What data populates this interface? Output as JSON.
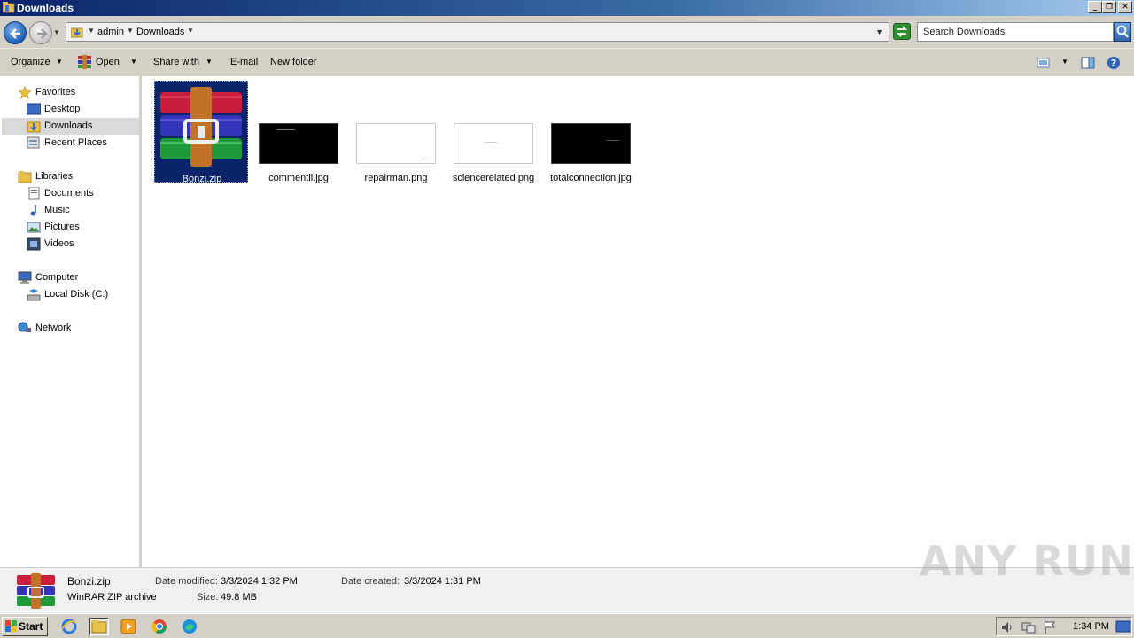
{
  "window": {
    "title": "Downloads"
  },
  "caption_buttons": {
    "minimize": "_",
    "restore": "❐",
    "close": "✕"
  },
  "address": {
    "breadcrumbs": [
      "admin",
      "Downloads"
    ],
    "search_placeholder": "Search Downloads"
  },
  "toolbar": {
    "organize": "Organize",
    "open": "Open",
    "share_with": "Share with",
    "email": "E-mail",
    "new_folder": "New folder"
  },
  "nav": {
    "favorites": "Favorites",
    "desktop": "Desktop",
    "downloads": "Downloads",
    "recent_places": "Recent Places",
    "libraries": "Libraries",
    "documents": "Documents",
    "music": "Music",
    "pictures": "Pictures",
    "videos": "Videos",
    "computer": "Computer",
    "local_disk": "Local Disk (C:)",
    "network": "Network"
  },
  "files": [
    {
      "name": "Bonzi.zip"
    },
    {
      "name": "commentii.jpg"
    },
    {
      "name": "repairman.png"
    },
    {
      "name": "sciencerelated.png"
    },
    {
      "name": "totalconnection.jpg"
    }
  ],
  "details": {
    "name": "Bonzi.zip",
    "type": "WinRAR ZIP archive",
    "modified_label": "Date modified:",
    "modified_value": "3/3/2024 1:32 PM",
    "created_label": "Date created:",
    "created_value": "3/3/2024 1:31 PM",
    "size_label": "Size:",
    "size_value": "49.8 MB"
  },
  "watermark": "ANY RUN",
  "taskbar": {
    "start": "Start",
    "clock": "1:34 PM"
  }
}
